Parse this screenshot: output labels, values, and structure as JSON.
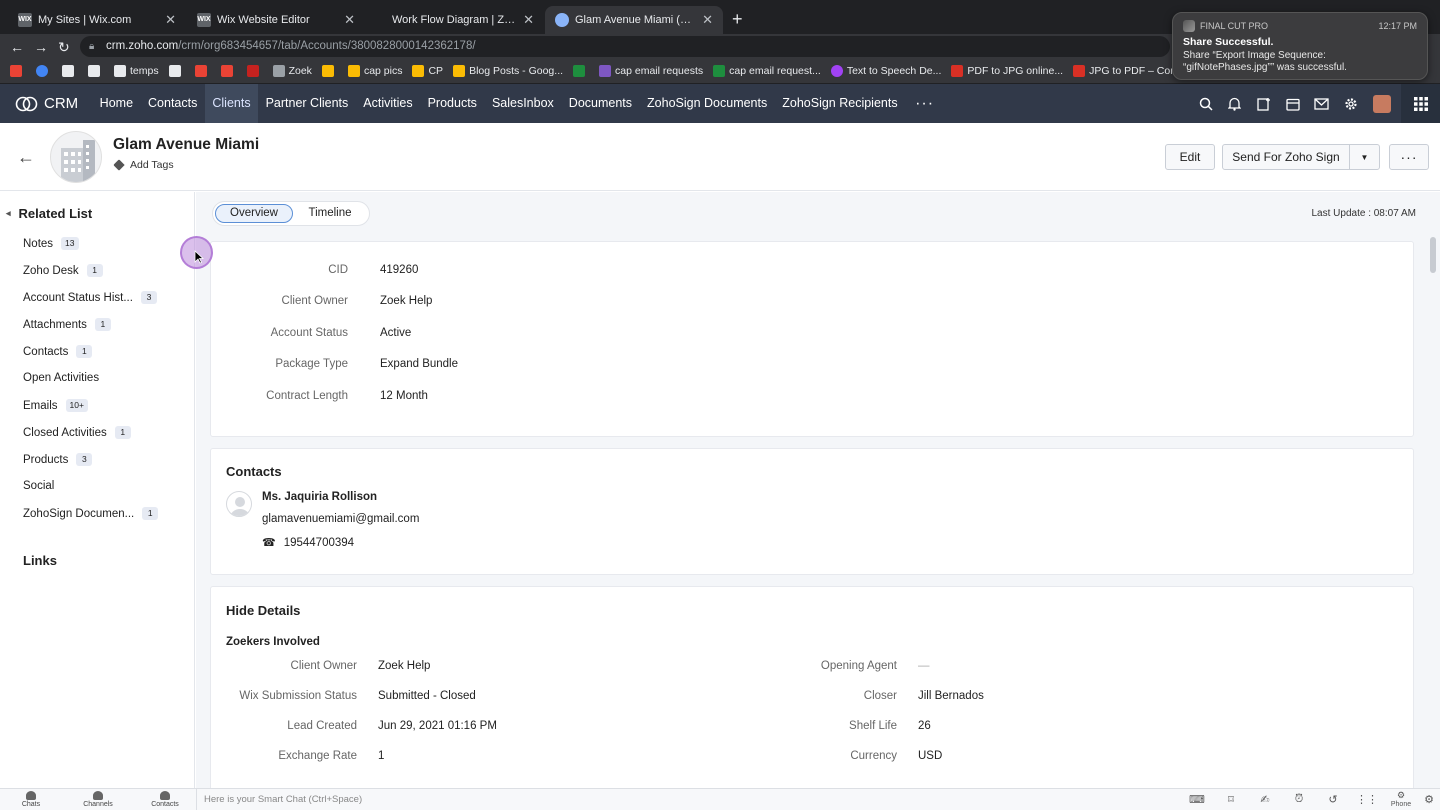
{
  "browser": {
    "tabs": [
      {
        "title": "My Sites | Wix.com",
        "icon": "wix-icon",
        "active": false
      },
      {
        "title": "Wix Website Editor",
        "icon": "wix-icon",
        "active": false
      },
      {
        "title": "Work Flow Diagram | Zoek Wor",
        "icon": "zoek-icon",
        "active": false
      },
      {
        "title": "Glam Avenue Miami (Client) - Z",
        "icon": "zoho-icon",
        "active": true
      }
    ],
    "url_host": "crm.zoho.com",
    "url_path": "/crm/org683454657/tab/Accounts/3800828000142362178/",
    "bookmarks": [
      "temps",
      "Zoek",
      "cap pics",
      "CP",
      "Blog Posts - Goog...",
      "cap email requests",
      "cap email request...",
      "Text to Speech De...",
      "PDF to JPG online...",
      "JPG to PDF – Con..."
    ],
    "bookmark_colors": {
      "folder": "#9aa0a6",
      "sheets": "#1e8e3e",
      "docs": "#4285f4"
    }
  },
  "notification": {
    "app": "FINAL CUT PRO",
    "time": "12:17 PM",
    "title": "Share Successful.",
    "body_line1": "Share “Export Image Sequence:",
    "body_line2": "“gifNotePhases.jpg”” was successful."
  },
  "crm_nav": {
    "logo": "CRM",
    "items": [
      "Home",
      "Contacts",
      "Clients",
      "Partner Clients",
      "Activities",
      "Products",
      "SalesInbox",
      "Documents",
      "ZohoSign Documents",
      "ZohoSign Recipients"
    ],
    "active_index": 2,
    "more": "···",
    "nav_bg": "#313949",
    "icons": [
      "search-icon",
      "bell-icon",
      "add-record-icon",
      "calendar-icon",
      "mail-icon",
      "gear-icon",
      "avatar",
      "apps-grid-icon"
    ]
  },
  "record": {
    "title": "Glam Avenue Miami",
    "add_tags": "Add Tags",
    "buttons": {
      "edit": "Edit",
      "send": "Send For Zoho Sign",
      "more": "···"
    }
  },
  "sidebar": {
    "heading": "Related List",
    "items": [
      {
        "label": "Notes",
        "count": "13"
      },
      {
        "label": "Zoho Desk",
        "count": "1"
      },
      {
        "label": "Account Status Hist...",
        "count": "3"
      },
      {
        "label": "Attachments",
        "count": "1"
      },
      {
        "label": "Contacts",
        "count": "1"
      },
      {
        "label": "Open Activities",
        "count": ""
      },
      {
        "label": "Emails",
        "count": "10+"
      },
      {
        "label": "Closed Activities",
        "count": "1"
      },
      {
        "label": "Products",
        "count": "3"
      },
      {
        "label": "Social",
        "count": ""
      },
      {
        "label": "ZohoSign Documen...",
        "count": "1"
      }
    ],
    "links_heading": "Links"
  },
  "main": {
    "tabs": [
      "Overview",
      "Timeline"
    ],
    "active_tab": 0,
    "last_update": "Last Update : 08:07 AM",
    "overview_fields": [
      {
        "label": "CID",
        "value": "419260"
      },
      {
        "label": "Client Owner",
        "value": "Zoek Help"
      },
      {
        "label": "Account Status",
        "value": "Active"
      },
      {
        "label": "Package Type",
        "value": "Expand Bundle"
      },
      {
        "label": "Contract Length",
        "value": "12 Month"
      }
    ],
    "contacts": {
      "title": "Contacts",
      "name": "Ms. Jaquiria Rollison",
      "email": "glamavenuemiami@gmail.com",
      "phone": "19544700394"
    },
    "details": {
      "title": "Hide Details",
      "section": "Zoekers Involved",
      "left": [
        {
          "label": "Client Owner",
          "value": "Zoek Help"
        },
        {
          "label": "Wix Submission Status",
          "value": "Submitted - Closed"
        },
        {
          "label": "Lead Created",
          "value": "Jun 29, 2021 01:16 PM"
        },
        {
          "label": "Exchange Rate",
          "value": "1"
        }
      ],
      "right": [
        {
          "label": "Opening Agent",
          "value": "—"
        },
        {
          "label": "Closer",
          "value": "Jill Bernados"
        },
        {
          "label": "Shelf Life",
          "value": "26"
        },
        {
          "label": "Currency",
          "value": "USD"
        }
      ]
    }
  },
  "bottom_bar": {
    "items": [
      "Chats",
      "Channels",
      "Contacts"
    ],
    "smart_chat": "Here is your Smart Chat (Ctrl+Space)",
    "phone": "Phone"
  }
}
